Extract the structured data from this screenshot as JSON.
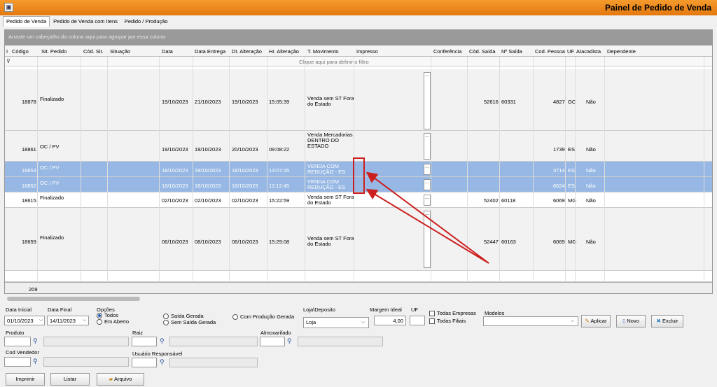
{
  "window": {
    "title": "Painel de Pedido de Venda",
    "app_icon": "app-icon"
  },
  "tabs": [
    "Pedido de Venda",
    "Pedido de Venda com Itens",
    "Pedido / Produção"
  ],
  "group_hint": "Arraste um cabeçalho da coluna aqui para agrupar por essa coluna",
  "columns": [
    "Código",
    "Sit. Pedido",
    "Cód. Sit.",
    "Situação",
    "Data",
    "Data Entrega",
    "Dt. Alteração",
    "Hr. Alteração",
    "T. Movimento",
    "Impresso",
    "Conferência",
    "Cód. Saída",
    "Nº Saída",
    "Cod. Pessoa",
    "UF",
    "Atacadista",
    "Dependente",
    "I"
  ],
  "filter_hint": "Clique aqui para definir o filtro",
  "rows": [
    {
      "codigo": "18878",
      "sit": "Finalizado",
      "data": "19/10/2023",
      "entrega": "21/10/2023",
      "alteracao": "19/10/2023",
      "hora": "15:05:39",
      "tmov": "Venda sem ST Fora do Estado",
      "cod_saida": "52616",
      "n_saida": "60331",
      "pessoa": "4827",
      "uf": "GO",
      "atacadista": "Não"
    },
    {
      "codigo": "18861",
      "sit": "OC / PV",
      "data": "19/10/2023",
      "entrega": "19/10/2023",
      "alteracao": "20/10/2023",
      "hora": "09:08:22",
      "tmov": "Venda Mercadorias DENTRO DO ESTADO",
      "cod_saida": "",
      "n_saida": "",
      "pessoa": "1739",
      "uf": "ES",
      "atacadista": "Não"
    },
    {
      "codigo": "18853",
      "sit": "OC / PV",
      "data": "18/10/2023",
      "entrega": "18/10/2023",
      "alteracao": "18/10/2023",
      "hora": "13:07:35",
      "tmov": "VENDA COM REDUÇÃO - ES",
      "cod_saida": "",
      "n_saida": "",
      "pessoa": "3714",
      "uf": "ES",
      "atacadista": "Não"
    },
    {
      "codigo": "18852",
      "sit": "OC / PV",
      "data": "18/10/2023",
      "entrega": "18/10/2023",
      "alteracao": "18/10/2023",
      "hora": "12:12:45",
      "tmov": "VENDA COM REDUÇÃO - ES",
      "cod_saida": "",
      "n_saida": "",
      "pessoa": "6624",
      "uf": "ES",
      "atacadista": "Não"
    },
    {
      "codigo": "18615",
      "sit": "Finalizado",
      "data": "02/10/2023",
      "entrega": "02/10/2023",
      "alteracao": "02/10/2023",
      "hora": "15:22:59",
      "tmov": "Venda sem ST Fora do Estado",
      "cod_saida": "52402",
      "n_saida": "60118",
      "pessoa": "6069",
      "uf": "MG",
      "atacadista": "Não"
    },
    {
      "codigo": "18659",
      "sit": "Finalizado",
      "data": "06/10/2023",
      "entrega": "08/10/2023",
      "alteracao": "06/10/2023",
      "hora": "15:29:08",
      "tmov": "Venda sem ST Fora do Estado",
      "cod_saida": "52447",
      "n_saida": "60163",
      "pessoa": "6069",
      "uf": "MG",
      "atacadista": "Não"
    }
  ],
  "impresso_mark": "...",
  "footer_count": "209",
  "filters": {
    "data_inicial_label": "Data Inicial",
    "data_inicial": "01/10/2023",
    "data_final_label": "Data Final",
    "data_final": "14/11/2023",
    "opcoes_label": "Opções",
    "opt_todos": "Todos",
    "opt_em_aberto": "Em Aberto",
    "opt_saida_gerada": "Saída Gerada",
    "opt_sem_saida": "Sem Saída Gerada",
    "opt_producao": "Com Produção Gerada",
    "loja_label": "Loja\\Deposito",
    "loja_value": "Loja",
    "margem_label": "Margem Ideal",
    "margem_value": "4,00",
    "uf_label": "UF",
    "todas_empresas": "Todas Empresas",
    "todas_filiais": "Todas Filiais",
    "modelos_label": "Modelos",
    "produto_label": "Produto",
    "raiz_label": "Raiz",
    "almox_label": "Almoxarifado",
    "vendedor_label": "Cod Vendedor",
    "usuario_label": "Usuário Responsável"
  },
  "buttons": {
    "aplicar": "Aplicar",
    "novo": "Novo",
    "excluir": "Excluir",
    "imprimir": "Imprimir",
    "listar": "Listar",
    "arquivo": "Arquivo"
  },
  "colors": {
    "titlebar": "#e8820f",
    "selected_row": "#97b8e4",
    "annotation": "#cc1f1f"
  }
}
